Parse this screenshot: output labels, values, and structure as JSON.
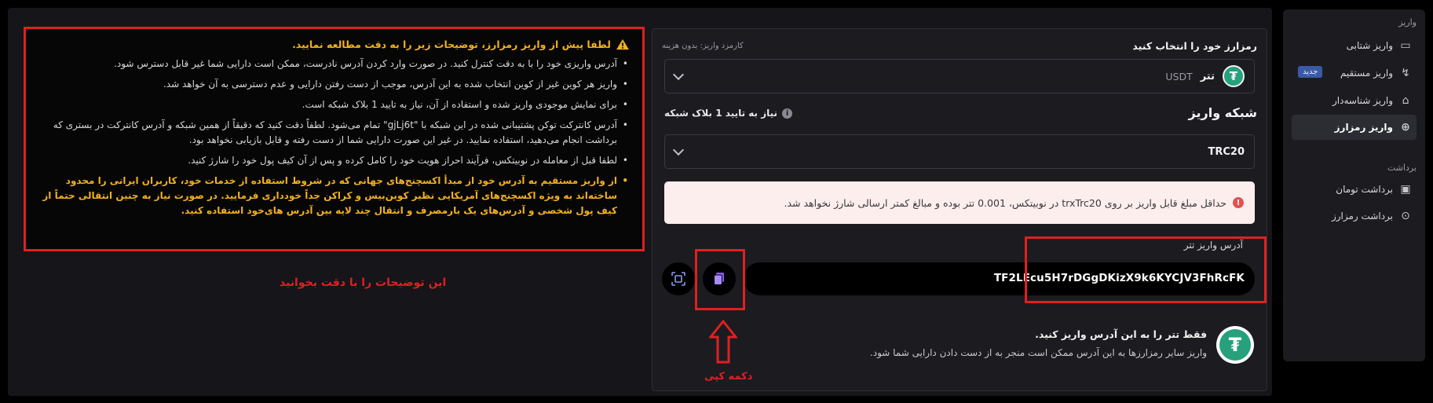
{
  "sidebar": {
    "deposit_title": "واریز",
    "items": [
      {
        "label": "واریز شتابی",
        "icon": "card-icon"
      },
      {
        "label": "واریز مستقیم",
        "icon": "direct-icon",
        "badge": "جدید"
      },
      {
        "label": "واریز شناسه‌دار",
        "icon": "bank-icon"
      },
      {
        "label": "واریز رمزارز",
        "icon": "deposit-crypto-icon",
        "active": true
      }
    ],
    "withdraw_title": "برداشت",
    "withdraw_items": [
      {
        "label": "برداشت تومان",
        "icon": "wallet-icon"
      },
      {
        "label": "برداشت رمزارز",
        "icon": "upload-crypto-icon"
      }
    ]
  },
  "instructions": {
    "title": "لطفا پیش از واریز رمزارز، توضیحات زیر را به دقت مطالعه نمایید.",
    "items": [
      "آدرس واریزی خود را با به دقت کنترل کنید. در صورت وارد کردن آدرس نادرست، ممکن است دارایی شما غیر قابل دسترس شود.",
      "واریز هر کوین غیر از کوین انتخاب شده به این آدرس، موجب از دست رفتن دارایی و عدم دسترسی به آن خواهد شد.",
      "برای نمایش موجودی واریز شده و استفاده از آن، نیاز به تایید 1 بلاک شبکه است.",
      "آدرس کانترکت توکن پشتیبانی شده در این شبکه با \"gjLj6t\" تمام می‌شود. لطفاً دقت کنید که دقیقاً از همین شبکه و آدرس کانترکت در بستری که برداشت انجام می‌دهید، استفاده نمایید. در غیر این صورت دارایی شما از دست رفته و قابل بازیابی نخواهد بود.",
      "لطفا قبل از معامله در نوبیتکس، فرآیند احراز هویت خود را کامل کرده و پس از آن کیف پول خود را شارژ کنید."
    ],
    "highlight": "از واریز مستقیم به آدرس خود از مبدأ اکسچنج‌های جهانی که در شروط استفاده از خدمات خود، کاربران ایرانی را محدود ساخته‌اند به ویژه اکسچنج‌های آمریکایی نظیر کوین‌بیس و کراکن جداً خودداری فرمایید. در صورت نیاز به چنین انتقالی حتماً از کیف پول شخصی و آدرس‌های یک بارمصرف و انتقال چند لایه بین آدرس های‌خود استفاده کنید."
  },
  "annotations": {
    "read_note": "این توضیحات را با دقت بخوانید",
    "copy_label": "دکمه کپی"
  },
  "card": {
    "select_label": "رمزارز خود را انتخاب کنید",
    "fee_label": "کارمزد واریز: بدون هزینه",
    "coin_name": "تتر",
    "coin_symbol": "USDT",
    "coin_glyph": "₮",
    "network_label": "شبکه واریز",
    "confirm_label": "نیاز به تایید 1 بلاک شبکه",
    "network_value": "TRC20",
    "min_notice": "حداقل مبلغ قابل واریز بر روی trxTrc20 در نوبیتکس، 0.001 تتر بوده و مبالغ کمتر ارسالی شارژ نخواهد شد.",
    "address_label": "آدرس واریز تتر",
    "address": "TF2LEcu5H7rDGgDKizX9k6KYCJV3FhRcFK",
    "only_title": "فقط تتر را به این آدرس واریز کنید.",
    "only_desc": "واریز سایر رمزارزها به این آدرس ممکن است منجر به از دست دادن دارایی شما شود."
  },
  "colors": {
    "annotation_red": "#e02020",
    "warning_yellow": "#f2b01e",
    "tether_green": "#26a17b",
    "badge_blue": "#3a5aa8"
  }
}
